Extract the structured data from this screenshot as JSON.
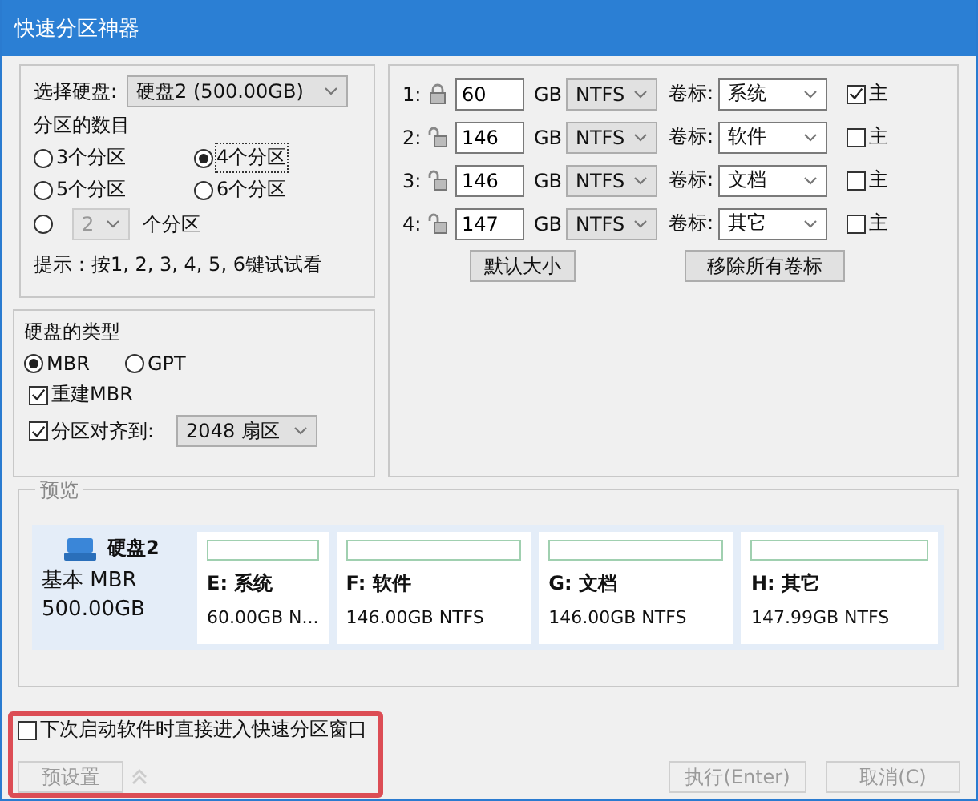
{
  "window": {
    "title": "快速分区神器"
  },
  "disk_select": {
    "label": "选择硬盘:",
    "value": "硬盘2 (500.00GB)"
  },
  "partition_count": {
    "label": "分区的数目",
    "options": [
      {
        "label": "3个分区",
        "selected": false
      },
      {
        "label": "4个分区",
        "selected": true
      },
      {
        "label": "5个分区",
        "selected": false
      },
      {
        "label": "6个分区",
        "selected": false
      }
    ],
    "custom": {
      "selected": false,
      "value": "2",
      "disabled": true,
      "suffix": "个分区"
    },
    "hint": "提示：按1, 2, 3, 4, 5, 6键试试看"
  },
  "disk_type": {
    "label": "硬盘的类型",
    "options": [
      {
        "label": "MBR",
        "selected": true
      },
      {
        "label": "GPT",
        "selected": false
      }
    ],
    "rebuild_mbr": {
      "label": "重建MBR",
      "checked": true
    },
    "align": {
      "label": "分区对齐到:",
      "checked": true,
      "value": "2048 扇区"
    }
  },
  "partitions": [
    {
      "index": "1:",
      "locked": true,
      "size": "60",
      "unit": "GB",
      "fs": "NTFS",
      "label_caption": "卷标:",
      "label": "系统",
      "primary": true,
      "primary_label": "主"
    },
    {
      "index": "2:",
      "locked": false,
      "size": "146",
      "unit": "GB",
      "fs": "NTFS",
      "label_caption": "卷标:",
      "label": "软件",
      "primary": false,
      "primary_label": "主"
    },
    {
      "index": "3:",
      "locked": false,
      "size": "146",
      "unit": "GB",
      "fs": "NTFS",
      "label_caption": "卷标:",
      "label": "文档",
      "primary": false,
      "primary_label": "主"
    },
    {
      "index": "4:",
      "locked": false,
      "size": "147",
      "unit": "GB",
      "fs": "NTFS",
      "label_caption": "卷标:",
      "label": "其它",
      "primary": false,
      "primary_label": "主"
    }
  ],
  "partition_buttons": [
    "默认大小",
    "移除所有卷标"
  ],
  "preview": {
    "title": "预览",
    "disk": {
      "name": "硬盘2",
      "type": "基本 MBR",
      "size": "500.00GB"
    },
    "volumes": [
      {
        "name": "E: 系统",
        "detail": "60.00GB N..."
      },
      {
        "name": "F: 软件",
        "detail": "146.00GB NTFS"
      },
      {
        "name": "G: 文档",
        "detail": "146.00GB NTFS"
      },
      {
        "name": "H: 其它",
        "detail": "147.99GB NTFS"
      }
    ]
  },
  "startup_checkbox": {
    "label": "下次启动软件时直接进入快速分区窗口",
    "checked": false
  },
  "buttons": [
    {
      "kind": "preset",
      "label": "预设置",
      "disabled": true
    },
    {
      "kind": "execute",
      "label": "执行(Enter)",
      "disabled": true
    },
    {
      "kind": "cancel",
      "label": "取消(C)",
      "disabled": true
    }
  ]
}
